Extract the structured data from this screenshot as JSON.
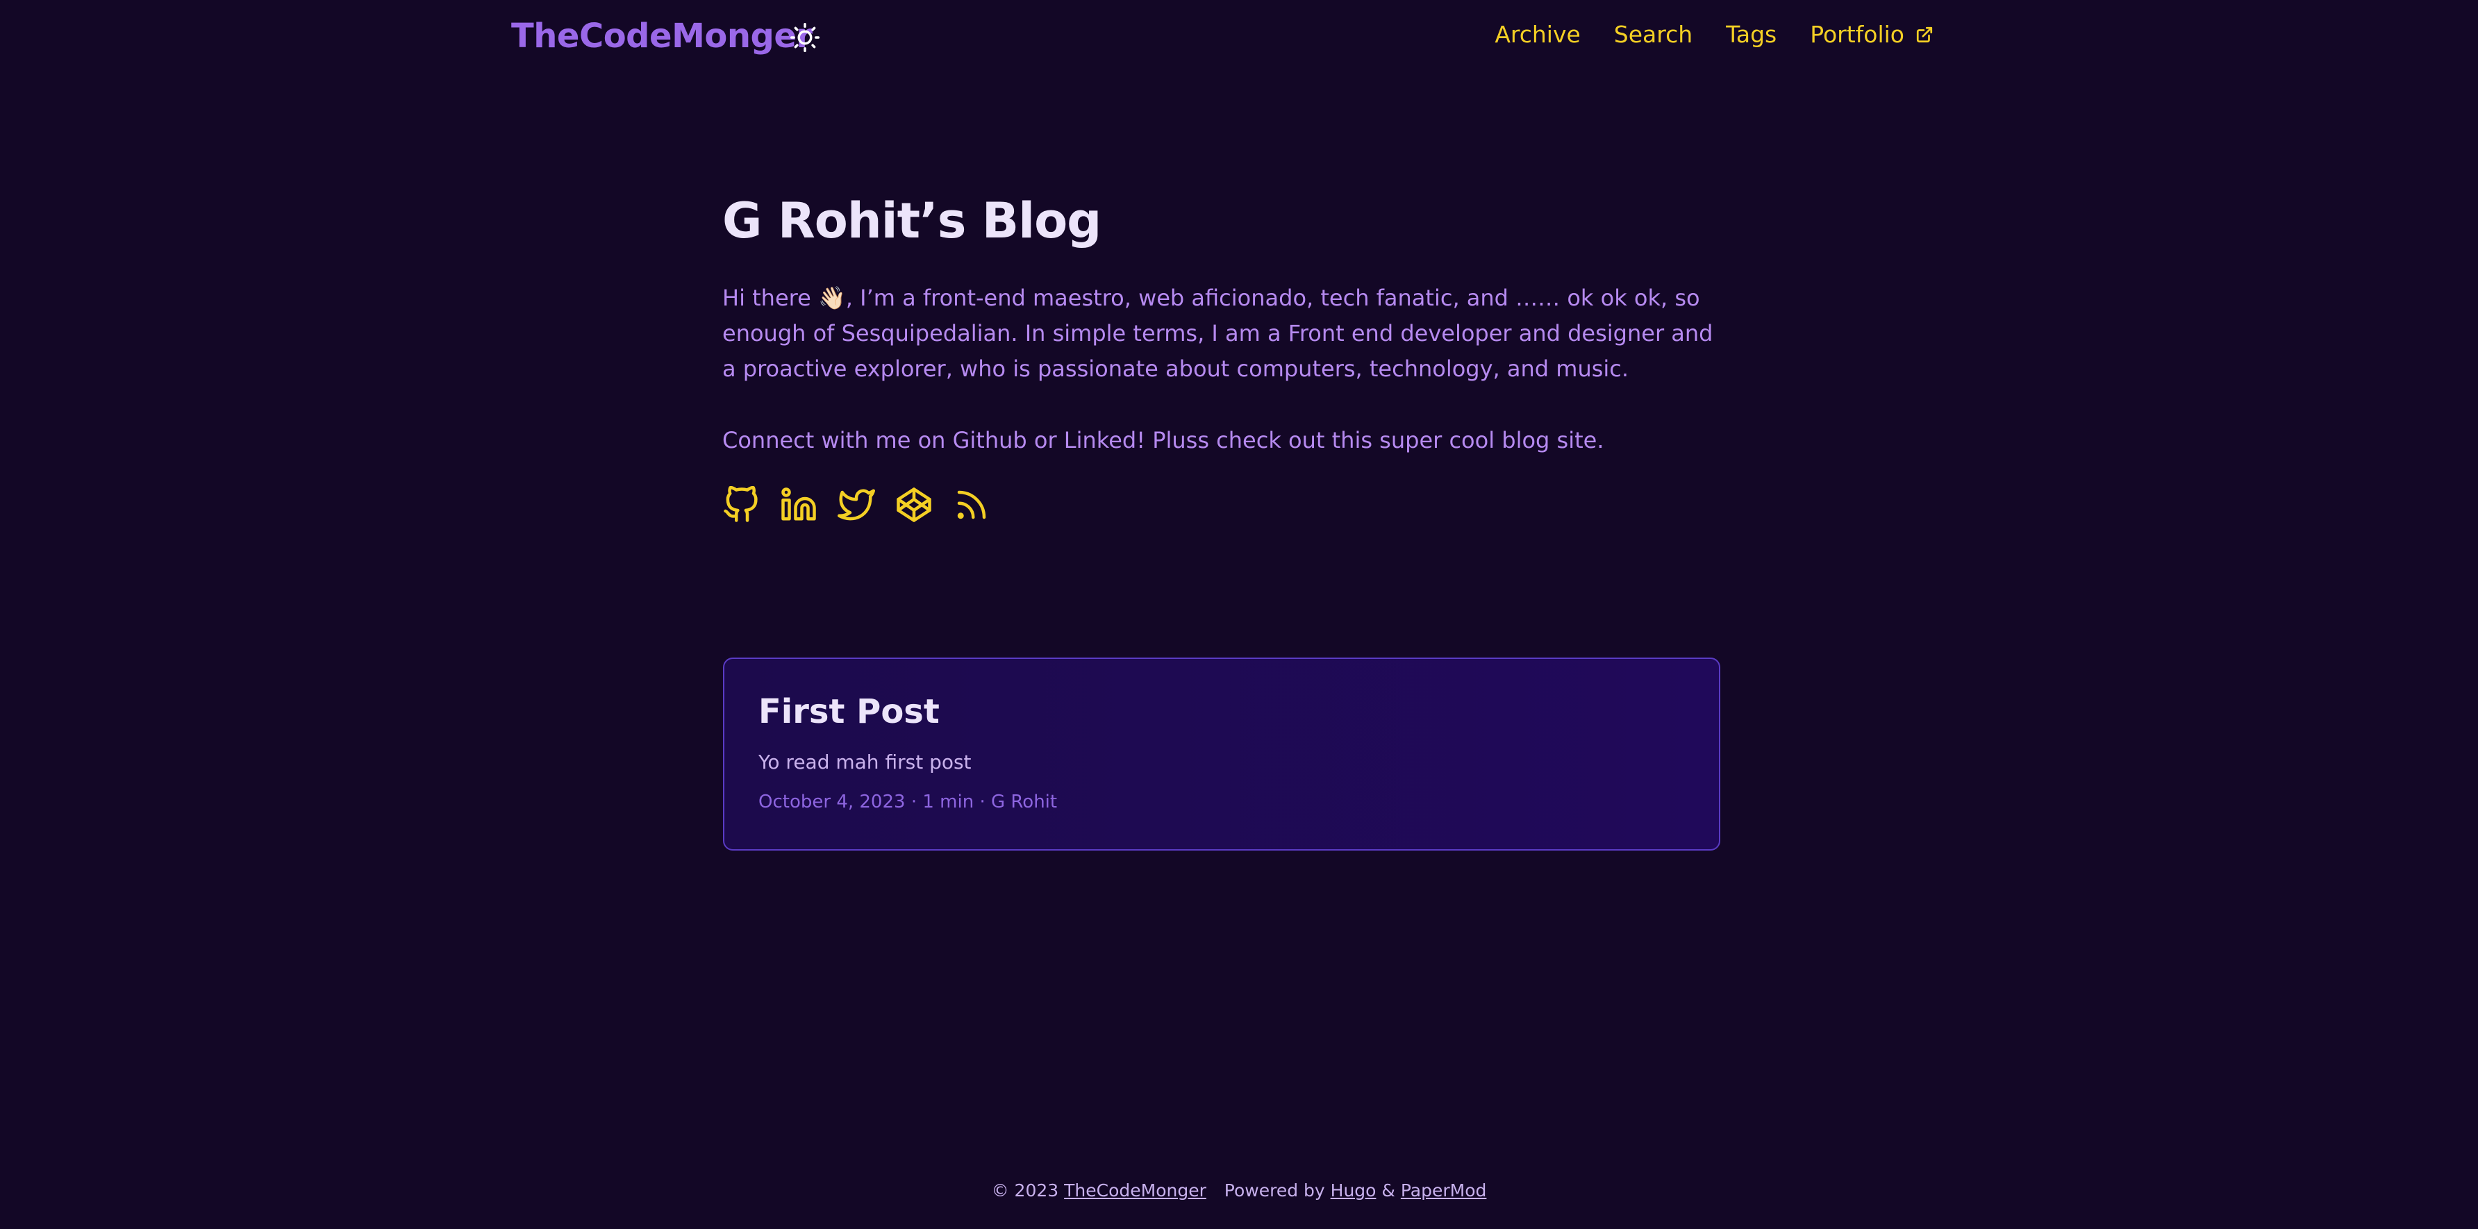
{
  "header": {
    "logo": "TheCodeMonger",
    "nav": [
      {
        "label": "Archive"
      },
      {
        "label": "Search"
      },
      {
        "label": "Tags"
      },
      {
        "label": "Portfolio"
      }
    ]
  },
  "main": {
    "title": "G Rohit’s Blog",
    "intro_part1": "Hi there",
    "wave_emoji": "👋🏻",
    "intro_part2": ", I’m a front-end maestro, web aficionado, tech fanatic, and …… ok ok ok, so enough of Sesquipedalian. In simple terms, I am a Front end developer and designer and a proactive explorer, who is passionate about computers, technology, and music.",
    "connect": "Connect with me on Github or Linked! Pluss check out this super cool blog site.",
    "social_icons": [
      "github-icon",
      "linkedin-icon",
      "twitter-icon",
      "codepen-icon",
      "rss-icon"
    ]
  },
  "post": {
    "title": "First Post",
    "summary": "Yo read mah first post",
    "meta": "October 4, 2023 · 1 min · G Rohit"
  },
  "footer": {
    "copyright": "© 2023",
    "site_link": "TheCodeMonger",
    "powered_by": "Powered by",
    "hugo": "Hugo",
    "amp": "&",
    "papermod": "PaperMod"
  },
  "colors": {
    "background": "#130726",
    "accent_yellow": "#f4cf24",
    "logo_purple": "#9a68e8",
    "text_purple": "#b68af0",
    "card_border": "#5a3bc4"
  }
}
